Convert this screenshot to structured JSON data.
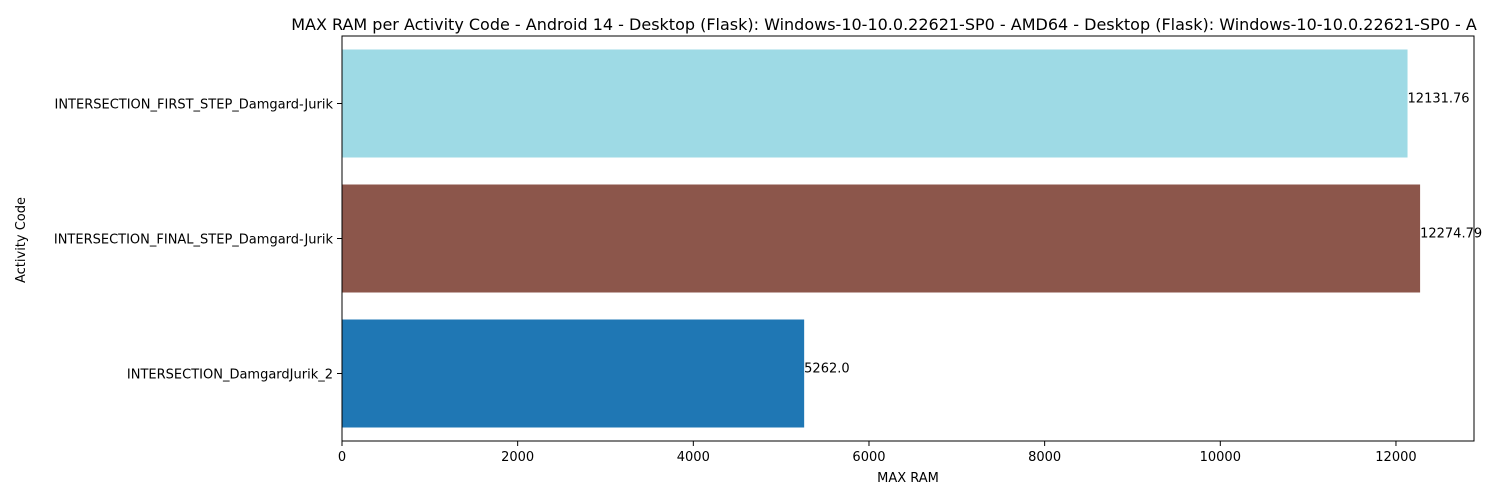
{
  "chart_data": {
    "type": "bar",
    "orientation": "horizontal",
    "title": "MAX RAM per Activity Code - Android 14 - Desktop (Flask): Windows-10-10.0.22621-SP0 - AMD64 - Desktop (Flask): Windows-10-10.0.22621-SP0 - A",
    "xlabel": "MAX RAM",
    "ylabel": "Activity Code",
    "categories": [
      "INTERSECTION_FIRST_STEP_Damgard-Jurik",
      "INTERSECTION_FINAL_STEP_Damgard-Jurik",
      "INTERSECTION_DamgardJurik_2"
    ],
    "values": [
      12131.76,
      12274.79,
      5262.0
    ],
    "value_labels": [
      "12131.76",
      "12274.79",
      "5262.0"
    ],
    "colors": [
      "#9edae5",
      "#8c564b",
      "#1f77b4"
    ],
    "xlim": [
      0,
      12888.5
    ],
    "xticks": [
      0,
      2000,
      4000,
      6000,
      8000,
      10000,
      12000
    ],
    "grid": false,
    "legend": "none"
  }
}
